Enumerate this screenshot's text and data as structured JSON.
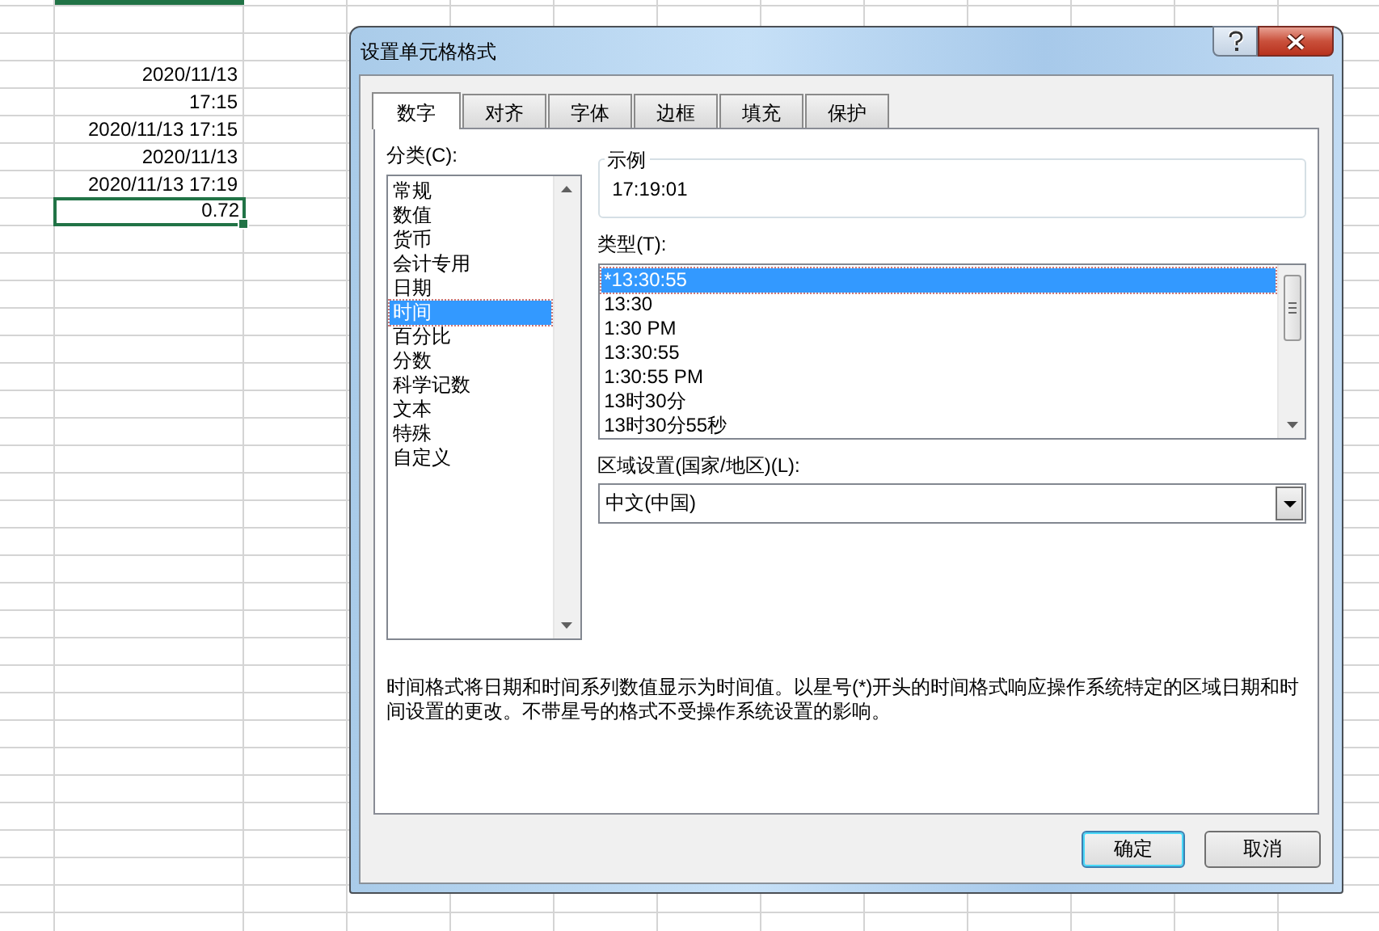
{
  "sheet": {
    "cells": [
      {
        "text": "2020/11/13",
        "selected": false
      },
      {
        "text": "17:15",
        "selected": false
      },
      {
        "text": "2020/11/13 17:15",
        "selected": false
      },
      {
        "text": "2020/11/13",
        "selected": false
      },
      {
        "text": "2020/11/13 17:19",
        "selected": false
      },
      {
        "text": "0.72",
        "selected": true
      }
    ]
  },
  "dialog": {
    "title": "设置单元格格式",
    "tabs": [
      {
        "label": "数字",
        "selected": true
      },
      {
        "label": "对齐",
        "selected": false
      },
      {
        "label": "字体",
        "selected": false
      },
      {
        "label": "边框",
        "selected": false
      },
      {
        "label": "填充",
        "selected": false
      },
      {
        "label": "保护",
        "selected": false
      }
    ],
    "category": {
      "label": "分类(C):",
      "items": [
        {
          "label": "常规",
          "selected": false
        },
        {
          "label": "数值",
          "selected": false
        },
        {
          "label": "货币",
          "selected": false
        },
        {
          "label": "会计专用",
          "selected": false
        },
        {
          "label": "日期",
          "selected": false
        },
        {
          "label": "时间",
          "selected": true
        },
        {
          "label": "百分比",
          "selected": false
        },
        {
          "label": "分数",
          "selected": false
        },
        {
          "label": "科学记数",
          "selected": false
        },
        {
          "label": "文本",
          "selected": false
        },
        {
          "label": "特殊",
          "selected": false
        },
        {
          "label": "自定义",
          "selected": false
        }
      ]
    },
    "sample": {
      "label": "示例",
      "value": "17:19:01"
    },
    "type": {
      "label": "类型(T):",
      "items": [
        {
          "label": "*13:30:55",
          "selected": true
        },
        {
          "label": "13:30",
          "selected": false
        },
        {
          "label": "1:30 PM",
          "selected": false
        },
        {
          "label": "13:30:55",
          "selected": false
        },
        {
          "label": "1:30:55 PM",
          "selected": false
        },
        {
          "label": "13时30分",
          "selected": false
        },
        {
          "label": "13时30分55秒",
          "selected": false
        }
      ]
    },
    "locale": {
      "label": "区域设置(国家/地区)(L):",
      "value": "中文(中国)"
    },
    "description": "时间格式将日期和时间系列数值显示为时间值。以星号(*)开头的时间格式响应操作系统特定的区域日期和时间设置的更改。不带星号的格式不受操作系统设置的影响。",
    "buttons": [
      {
        "label": "确定",
        "kind": "default"
      },
      {
        "label": "取消",
        "kind": "normal"
      }
    ]
  }
}
